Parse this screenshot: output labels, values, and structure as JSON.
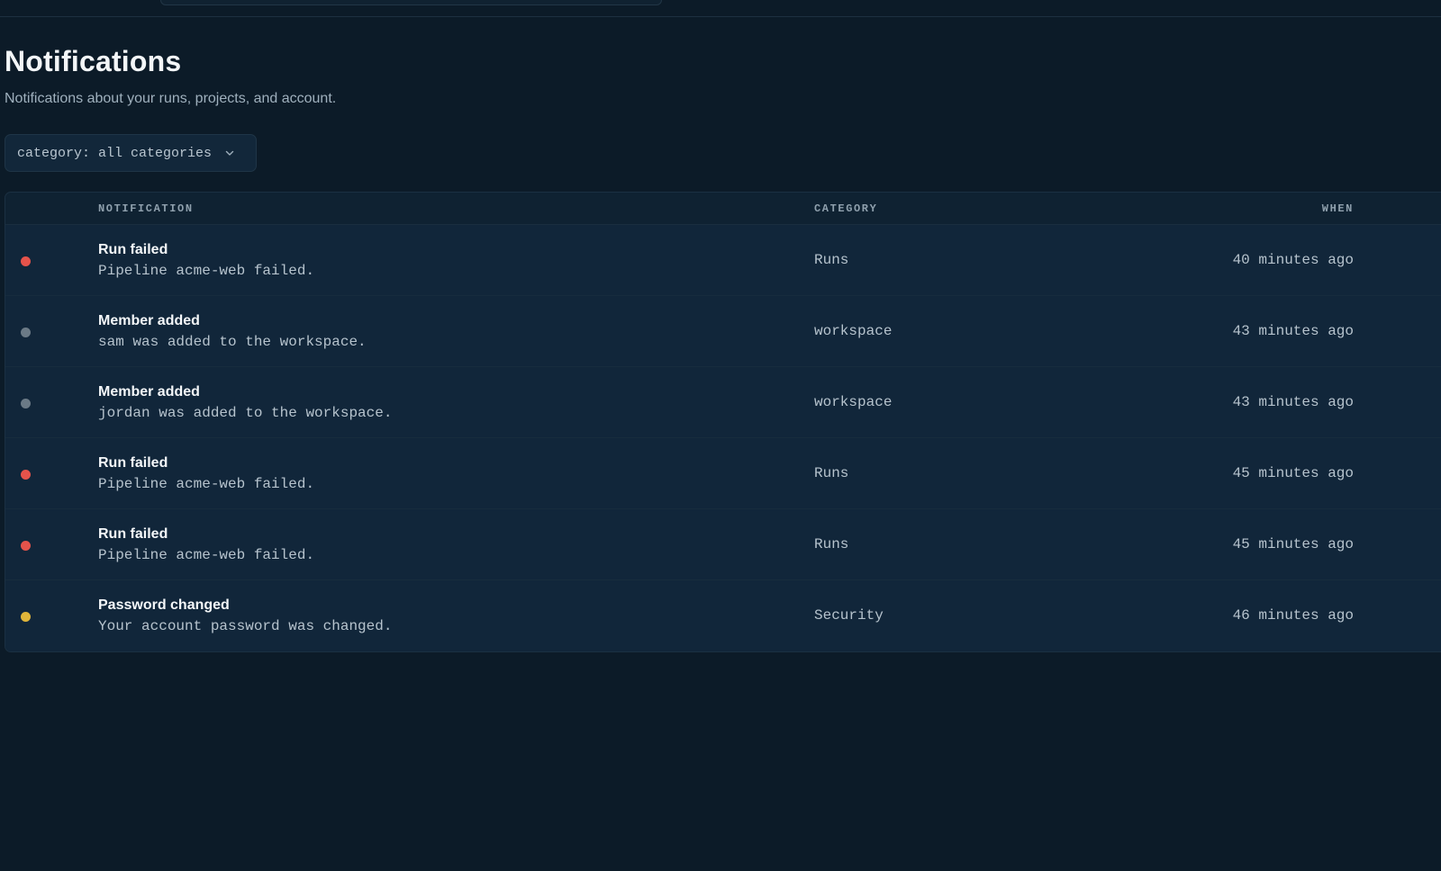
{
  "page": {
    "title": "Notifications",
    "subtitle": "Notifications about your runs, projects, and account."
  },
  "filter": {
    "label": "category: all categories"
  },
  "table": {
    "columns": {
      "notification": "NOTIFICATION",
      "category": "CATEGORY",
      "when": "WHEN"
    },
    "rows": [
      {
        "status": "error",
        "color": "#e5534b",
        "title": "Run failed",
        "body": "Pipeline acme-web failed.",
        "category": "Runs",
        "when": "40 minutes ago"
      },
      {
        "status": "info",
        "color": "#6b7a86",
        "title": "Member added",
        "body": "sam was added to the workspace.",
        "category": "workspace",
        "when": "43 minutes ago"
      },
      {
        "status": "info",
        "color": "#6b7a86",
        "title": "Member added",
        "body": "jordan was added to the workspace.",
        "category": "workspace",
        "when": "43 minutes ago"
      },
      {
        "status": "error",
        "color": "#e5534b",
        "title": "Run failed",
        "body": "Pipeline acme-web failed.",
        "category": "Runs",
        "when": "45 minutes ago"
      },
      {
        "status": "error",
        "color": "#e5534b",
        "title": "Run failed",
        "body": "Pipeline acme-web failed.",
        "category": "Runs",
        "when": "45 minutes ago"
      },
      {
        "status": "warning",
        "color": "#e0b53a",
        "title": "Password changed",
        "body": "Your account password was changed.",
        "category": "Security",
        "when": "46 minutes ago"
      }
    ]
  },
  "colors": {
    "background": "#0c1b28",
    "surface": "#11263a",
    "error": "#e5534b",
    "warning": "#e0b53a",
    "muted": "#6b7a86"
  }
}
